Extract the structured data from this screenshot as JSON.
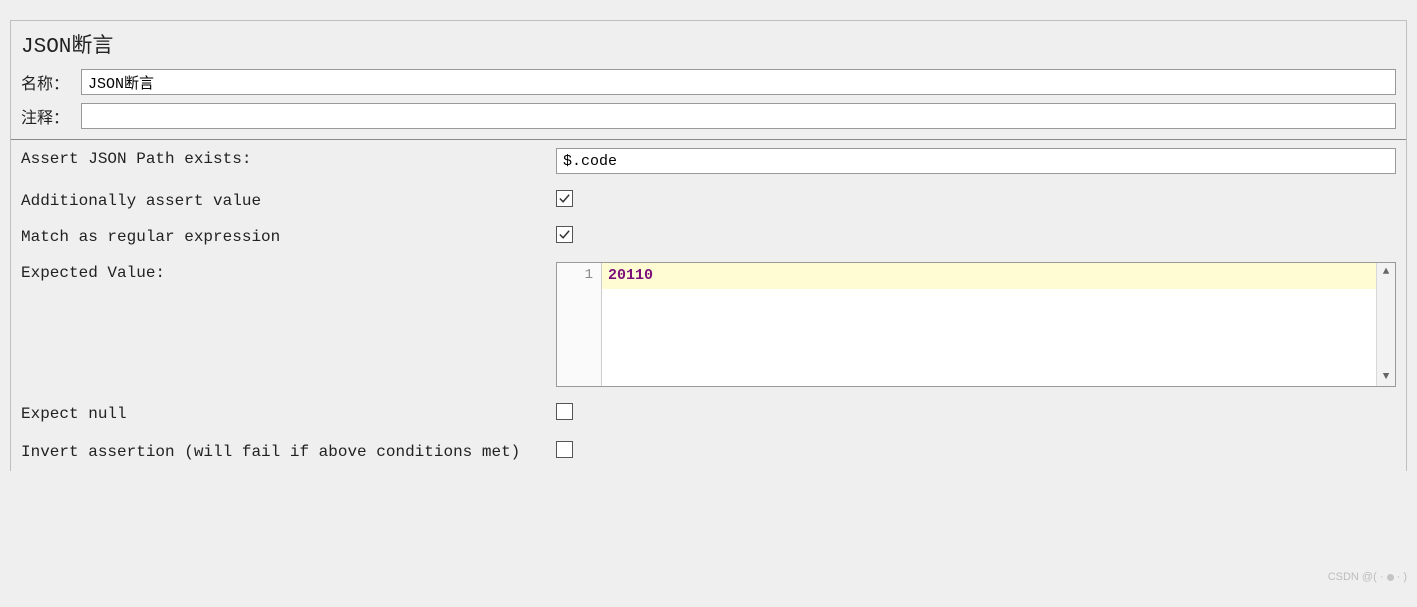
{
  "title": "JSON断言",
  "name_label": "名称：",
  "name_value": "JSON断言",
  "comment_label": "注释：",
  "comment_value": "",
  "fields": {
    "json_path": {
      "label": "Assert JSON Path exists:",
      "value": "$.code"
    },
    "assert_value": {
      "label": "Additionally assert value",
      "checked": true
    },
    "regex": {
      "label": "Match as regular expression",
      "checked": true
    },
    "expected": {
      "label": "Expected Value:",
      "line_number": "1",
      "value": "20110"
    },
    "expect_null": {
      "label": "Expect null",
      "checked": false
    },
    "invert": {
      "label": "Invert assertion (will fail if above conditions met)",
      "checked": false
    }
  },
  "watermark": "CSDN @( · "
}
